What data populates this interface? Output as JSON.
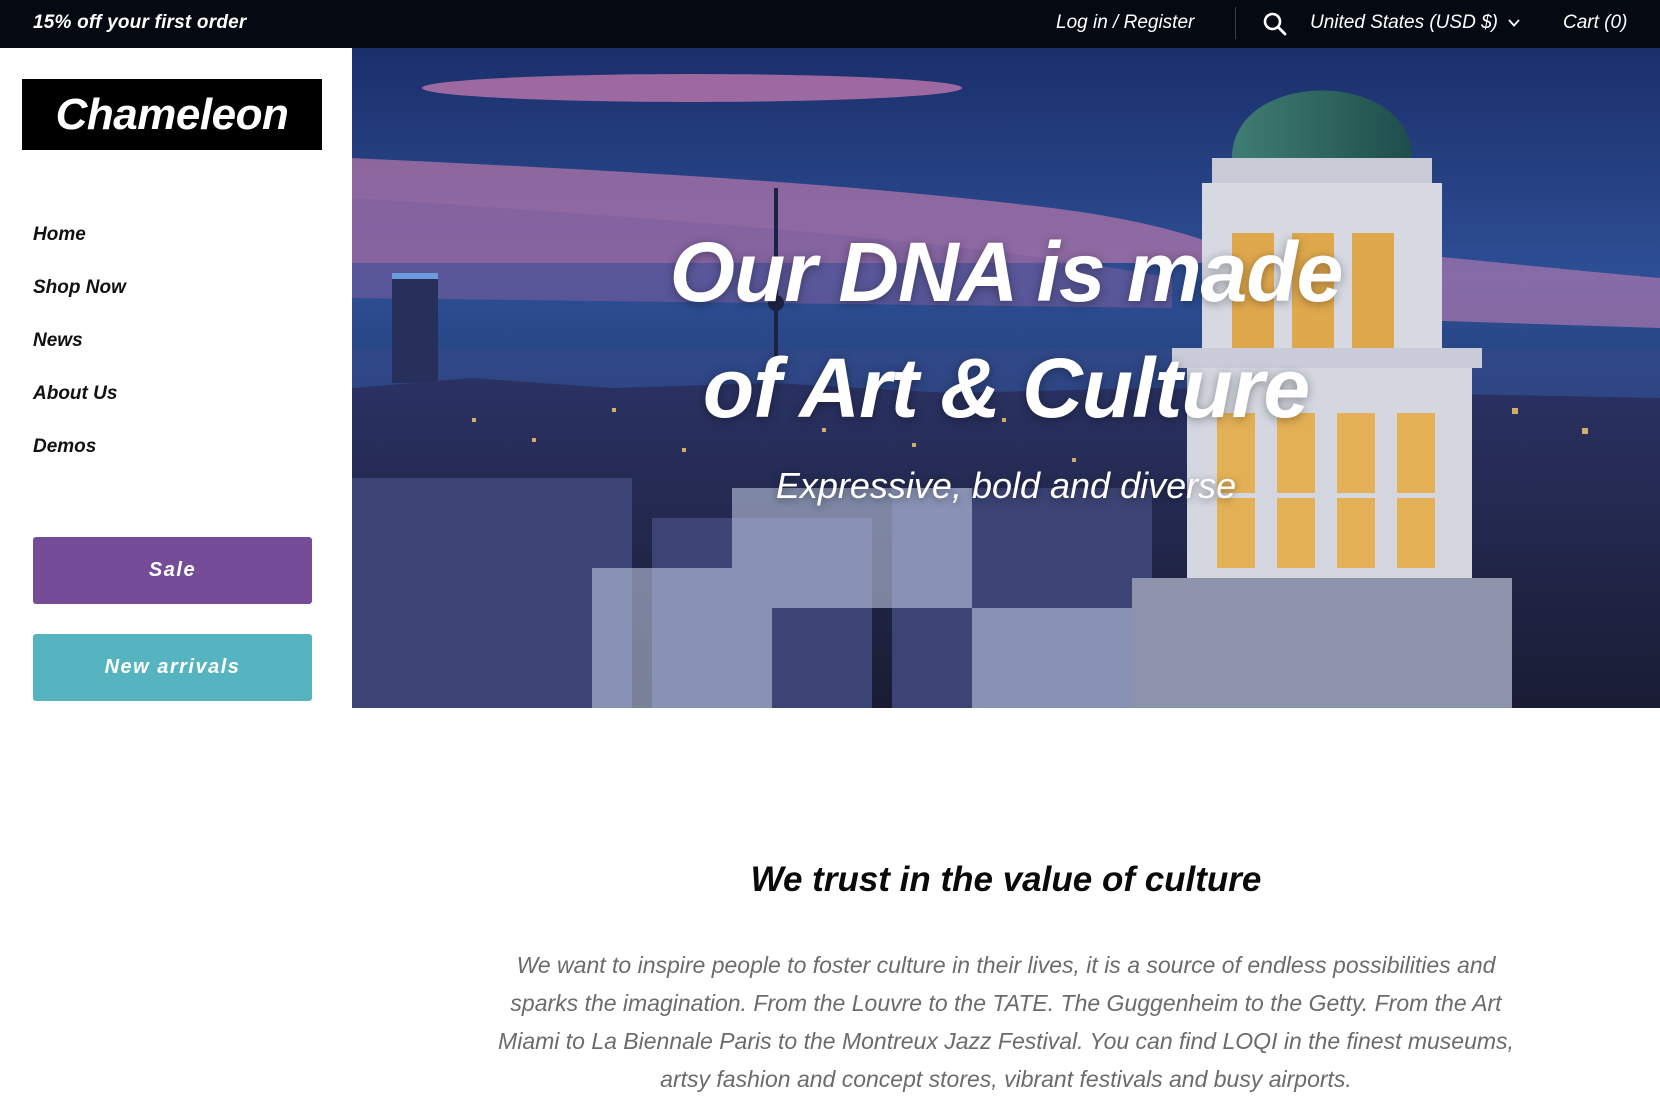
{
  "topbar": {
    "promo": "15% off your first order",
    "login": "Log in / Register",
    "currency": "United States (USD $)",
    "cart": "Cart (0)",
    "icons": [
      "search-icon",
      "chevron-down-icon"
    ]
  },
  "sidebar": {
    "logo": "Chameleon",
    "nav": [
      {
        "label": "Home"
      },
      {
        "label": "Shop Now"
      },
      {
        "label": "News"
      },
      {
        "label": "About Us"
      },
      {
        "label": "Demos"
      }
    ],
    "sale_button": "Sale",
    "new_arrivals_button": "New arrivals"
  },
  "hero": {
    "title_line1": "Our DNA is made",
    "title_line2": "of Art & Culture",
    "subtitle": "Expressive, bold and diverse"
  },
  "section": {
    "heading": "We trust in the value of culture",
    "body": "We want to inspire people to foster culture in their lives, it is a source of endless possibilities and sparks the imagination. From the Louvre to the TATE. The Guggenheim to the Getty. From the Art Miami to La Biennale Paris to the Montreux Jazz Festival. You can find LOQI in the finest museums, artsy fashion and concept stores, vibrant festivals and busy airports."
  },
  "colors": {
    "topbar_bg": "#050a12",
    "sale": "#744c98",
    "new_arrivals": "#55b4bf",
    "body_text": "#6b6b6b"
  }
}
